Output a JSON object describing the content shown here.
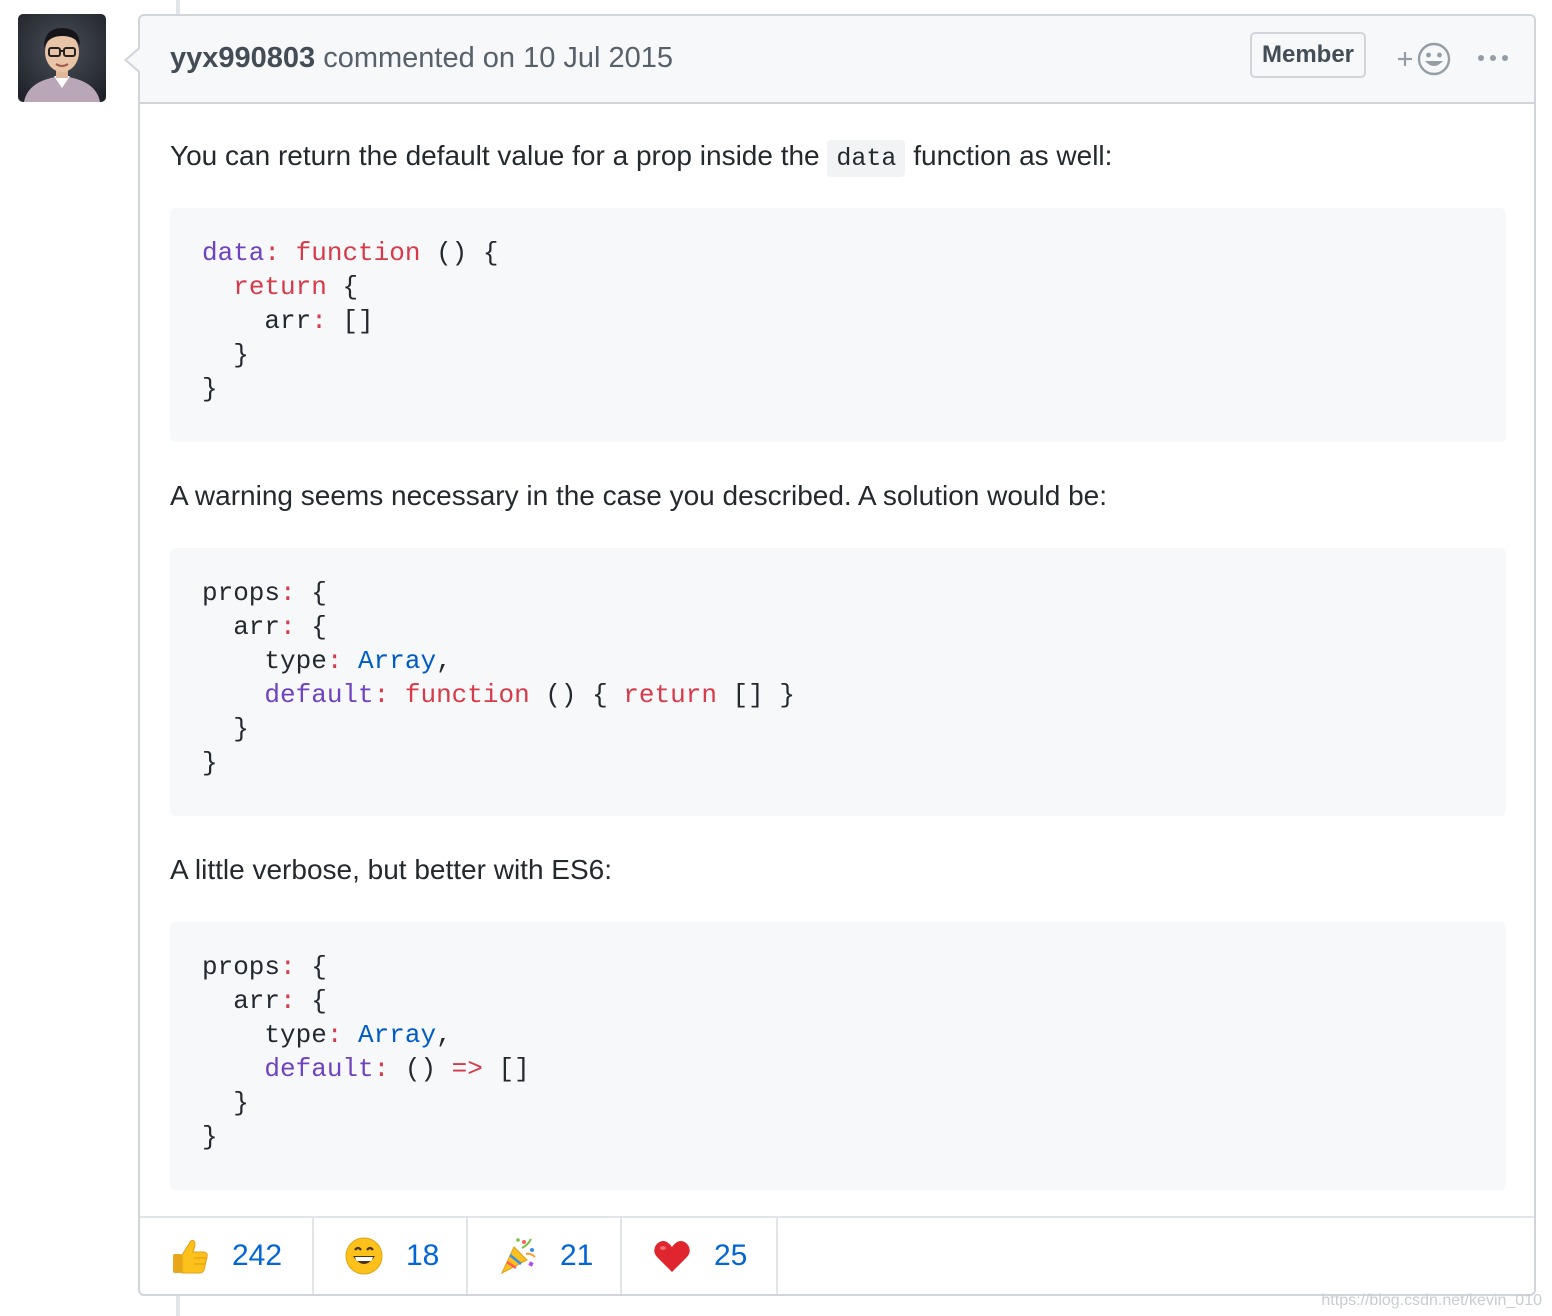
{
  "comment": {
    "author": "yyx990803",
    "action_text": "commented on 10 Jul 2015",
    "badge": "Member",
    "add_reaction_icon": "smiley-plus-icon",
    "more_icon": "kebab-horizontal-icon"
  },
  "body": {
    "p1_before": "You can return the default value for a prop inside the ",
    "p1_code": "data",
    "p1_after": " function as well:",
    "p2": "A warning seems necessary in the case you described. A solution would be:",
    "p3": "A little verbose, but better with ES6:"
  },
  "code_blocks": [
    {
      "lines": [
        [
          [
            "data",
            "purple"
          ],
          [
            ":",
            "red"
          ],
          [
            " ",
            "plain"
          ],
          [
            "function",
            "red"
          ],
          [
            " () {",
            "plain"
          ]
        ],
        [
          [
            "  ",
            "plain"
          ],
          [
            "return",
            "red"
          ],
          [
            " {",
            "plain"
          ]
        ],
        [
          [
            "    arr",
            "plain"
          ],
          [
            ":",
            "red"
          ],
          [
            " []",
            "plain"
          ]
        ],
        [
          [
            "  }",
            "plain"
          ]
        ],
        [
          [
            "}",
            "plain"
          ]
        ]
      ]
    },
    {
      "lines": [
        [
          [
            "props",
            "plain"
          ],
          [
            ":",
            "red"
          ],
          [
            " {",
            "plain"
          ]
        ],
        [
          [
            "  arr",
            "plain"
          ],
          [
            ":",
            "red"
          ],
          [
            " {",
            "plain"
          ]
        ],
        [
          [
            "    type",
            "plain"
          ],
          [
            ":",
            "red"
          ],
          [
            " ",
            "plain"
          ],
          [
            "Array",
            "blue"
          ],
          [
            ",",
            "plain"
          ]
        ],
        [
          [
            "    ",
            "plain"
          ],
          [
            "default",
            "purple"
          ],
          [
            ":",
            "red"
          ],
          [
            " ",
            "plain"
          ],
          [
            "function",
            "red"
          ],
          [
            " () { ",
            "plain"
          ],
          [
            "return",
            "red"
          ],
          [
            " [] }",
            "plain"
          ]
        ],
        [
          [
            "  }",
            "plain"
          ]
        ],
        [
          [
            "}",
            "plain"
          ]
        ]
      ]
    },
    {
      "lines": [
        [
          [
            "props",
            "plain"
          ],
          [
            ":",
            "red"
          ],
          [
            " {",
            "plain"
          ]
        ],
        [
          [
            "  arr",
            "plain"
          ],
          [
            ":",
            "red"
          ],
          [
            " {",
            "plain"
          ]
        ],
        [
          [
            "    type",
            "plain"
          ],
          [
            ":",
            "red"
          ],
          [
            " ",
            "plain"
          ],
          [
            "Array",
            "blue"
          ],
          [
            ",",
            "plain"
          ]
        ],
        [
          [
            "    ",
            "plain"
          ],
          [
            "default",
            "purple"
          ],
          [
            ":",
            "red"
          ],
          [
            " () ",
            "plain"
          ],
          [
            "=>",
            "red"
          ],
          [
            " []",
            "plain"
          ]
        ],
        [
          [
            "  }",
            "plain"
          ]
        ],
        [
          [
            "}",
            "plain"
          ]
        ]
      ]
    }
  ],
  "reactions": [
    {
      "icon": "thumbs-up-icon",
      "count": "242"
    },
    {
      "icon": "laugh-icon",
      "count": "18"
    },
    {
      "icon": "hooray-icon",
      "count": "21"
    },
    {
      "icon": "heart-icon",
      "count": "25"
    }
  ],
  "watermark": "https://blog.csdn.net/kevin_010",
  "colors": {
    "purple": "#6f42c1",
    "red": "#d73a49",
    "blue": "#005cc5",
    "link": "#0366d6",
    "border": "#d1d5da",
    "header_bg": "#f6f8fa"
  }
}
